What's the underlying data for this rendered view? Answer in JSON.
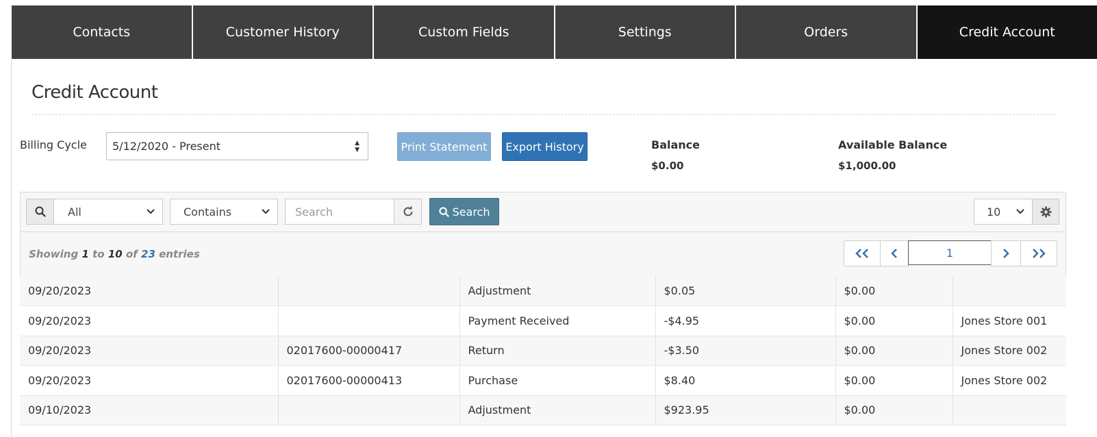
{
  "tabs": [
    {
      "label": "Contacts",
      "active": false
    },
    {
      "label": "Customer History",
      "active": false
    },
    {
      "label": "Custom Fields",
      "active": false
    },
    {
      "label": "Settings",
      "active": false
    },
    {
      "label": "Orders",
      "active": false
    },
    {
      "label": "Credit Account",
      "active": true
    }
  ],
  "page": {
    "title": "Credit Account",
    "billing_cycle_label": "Billing Cycle",
    "billing_cycle_value": "5/12/2020 - Present",
    "print_statement_label": "Print Statement",
    "export_history_label": "Export History",
    "balance_label": "Balance",
    "balance_value": "$0.00",
    "available_balance_label": "Available Balance",
    "available_balance_value": "$1,000.00"
  },
  "toolbar": {
    "field_select_value": "All",
    "operator_select_value": "Contains",
    "search_placeholder": "Search",
    "search_button_label": "Search",
    "page_size_value": "10"
  },
  "pagination": {
    "showing_prefix": "Showing",
    "from": "1",
    "to_word": "to",
    "to": "10",
    "of_word": "of",
    "total": "23",
    "entries_word": "entries",
    "current_page": "1"
  },
  "rows": [
    [
      "09/20/2023",
      "",
      "Adjustment",
      "$0.05",
      "$0.00",
      ""
    ],
    [
      "09/20/2023",
      "",
      "Payment Received",
      "-$4.95",
      "$0.00",
      "Jones Store 001"
    ],
    [
      "09/20/2023",
      "02017600-00000417",
      "Return",
      "-$3.50",
      "$0.00",
      "Jones Store 002"
    ],
    [
      "09/20/2023",
      "02017600-00000413",
      "Purchase",
      "$8.40",
      "$0.00",
      "Jones Store 002"
    ],
    [
      "09/10/2023",
      "",
      "Adjustment",
      "$923.95",
      "$0.00",
      ""
    ]
  ],
  "icons": {
    "search": "magnifier-icon",
    "refresh": "refresh-icon",
    "gear": "gear-icon",
    "first": "double-chevron-left-icon",
    "prev": "chevron-left-icon",
    "next": "chevron-right-icon",
    "last": "double-chevron-right-icon"
  },
  "colors": {
    "tab_bg": "#404040",
    "tab_active_bg": "#141414",
    "primary_button": "#2f73b4",
    "disabled_button": "#82aed5",
    "search_button": "#4f8199"
  }
}
